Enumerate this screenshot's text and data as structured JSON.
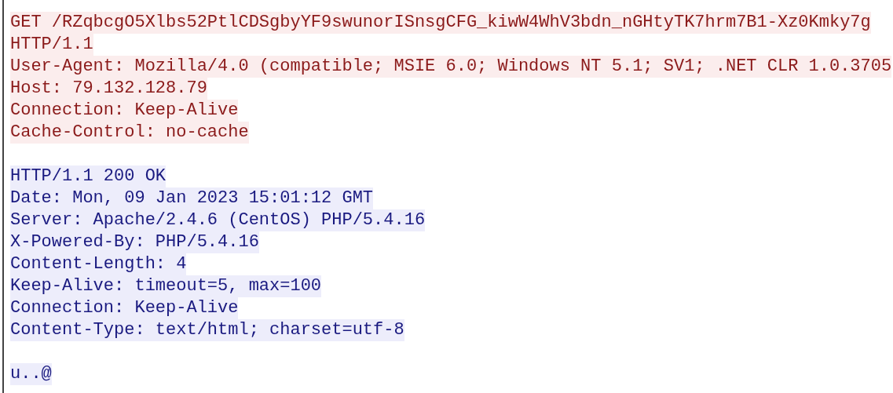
{
  "segments": [
    {
      "kind": "client",
      "lines": [
        "GET /RZqbcgO5Xlbs52PtlCDSgbyYF9swunorISnsgCFG_kiwW4WhV3bdn_nGHtyTK7hrm7B1-Xz0Kmky7g",
        "HTTP/1.1",
        "User-Agent: Mozilla/4.0 (compatible; MSIE 6.0; Windows NT 5.1; SV1; .NET CLR 1.0.3705",
        "Host: 79.132.128.79",
        "Connection: Keep-Alive",
        "Cache-Control: no-cache"
      ]
    },
    {
      "kind": "server",
      "lines": [
        "HTTP/1.1 200 OK",
        "Date: Mon, 09 Jan 2023 15:01:12 GMT",
        "Server: Apache/2.4.6 (CentOS) PHP/5.4.16",
        "X-Powered-By: PHP/5.4.16",
        "Content-Length: 4",
        "Keep-Alive: timeout=5, max=100",
        "Connection: Keep-Alive",
        "Content-Type: text/html; charset=utf-8"
      ]
    },
    {
      "kind": "server",
      "lines": [
        "u..@"
      ]
    }
  ]
}
